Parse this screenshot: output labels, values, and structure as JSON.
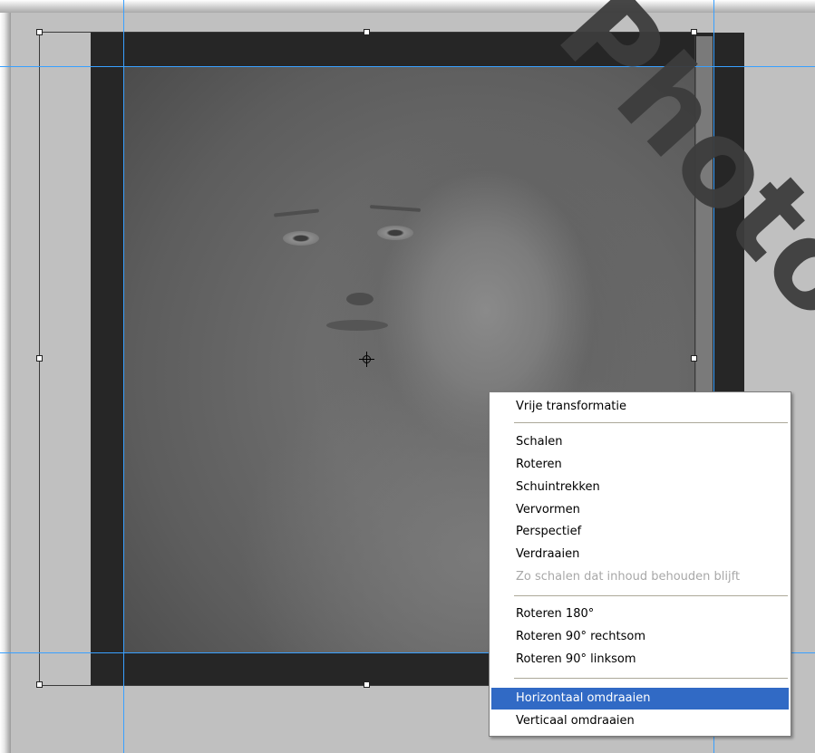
{
  "canvas": {
    "watermark_text": "Photo"
  },
  "context_menu": {
    "groups": [
      [
        "Vrije transformatie"
      ],
      [
        "Schalen",
        "Roteren",
        "Schuintrekken",
        "Vervormen",
        "Perspectief",
        "Verdraaien",
        "Zo schalen dat inhoud behouden blijft"
      ],
      [
        "Roteren 180°",
        "Roteren 90° rechtsom",
        "Roteren 90° linksom"
      ],
      [
        "Horizontaal omdraaien",
        "Verticaal omdraaien"
      ]
    ],
    "items": [
      {
        "label": "Vrije transformatie",
        "enabled": true,
        "highlighted": false
      },
      {
        "label": "Schalen",
        "enabled": true,
        "highlighted": false
      },
      {
        "label": "Roteren",
        "enabled": true,
        "highlighted": false
      },
      {
        "label": "Schuintrekken",
        "enabled": true,
        "highlighted": false
      },
      {
        "label": "Vervormen",
        "enabled": true,
        "highlighted": false
      },
      {
        "label": "Perspectief",
        "enabled": true,
        "highlighted": false
      },
      {
        "label": "Verdraaien",
        "enabled": true,
        "highlighted": false
      },
      {
        "label": "Zo schalen dat inhoud behouden blijft",
        "enabled": false,
        "highlighted": false
      },
      {
        "label": "Roteren 180°",
        "enabled": true,
        "highlighted": false
      },
      {
        "label": "Roteren 90° rechtsom",
        "enabled": true,
        "highlighted": false
      },
      {
        "label": "Roteren 90° linksom",
        "enabled": true,
        "highlighted": false
      },
      {
        "label": "Horizontaal omdraaien",
        "enabled": true,
        "highlighted": true
      },
      {
        "label": "Verticaal omdraaien",
        "enabled": true,
        "highlighted": false
      }
    ]
  },
  "colors": {
    "guide": "#39a0ff",
    "menu_highlight": "#316ac5",
    "canvas_bg": "#c0c0c0"
  }
}
